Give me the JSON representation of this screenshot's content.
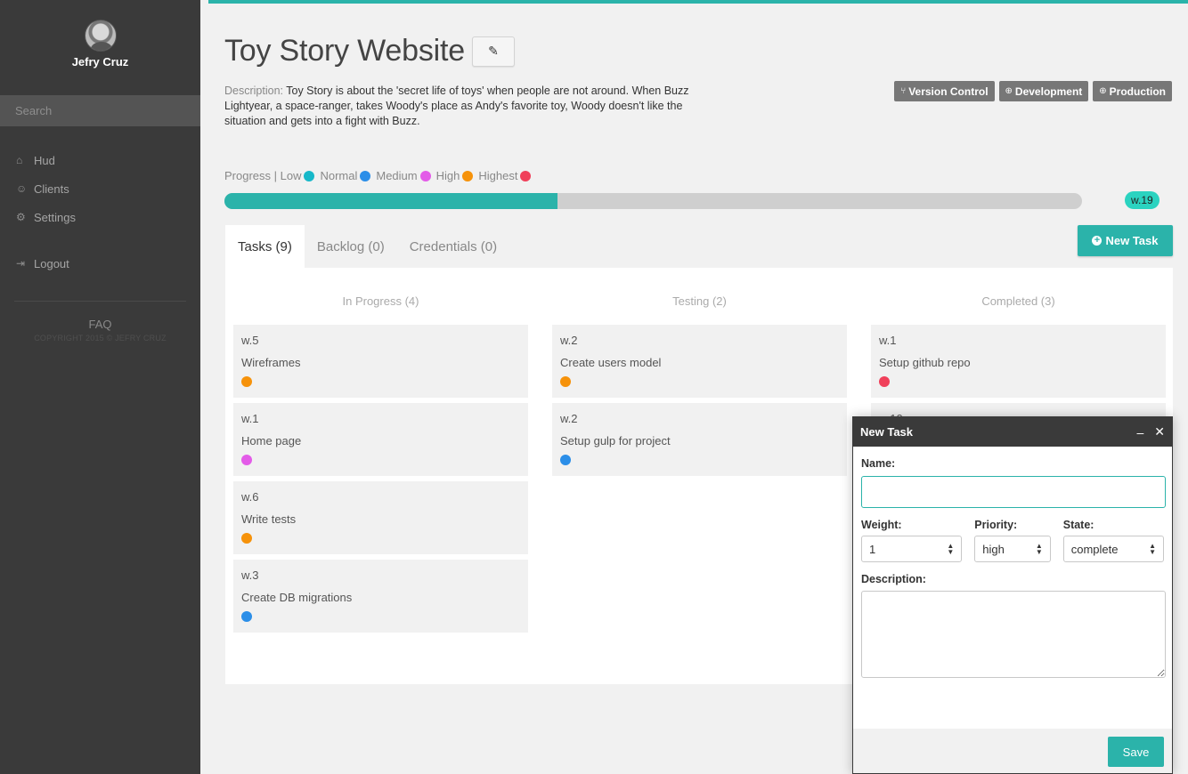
{
  "sidebar": {
    "user_name": "Jefry Cruz",
    "search_placeholder": "Search",
    "nav": [
      {
        "icon": "home-icon",
        "glyph": "⌂",
        "label": "Hud"
      },
      {
        "icon": "user-icon",
        "glyph": "☺",
        "label": "Clients"
      },
      {
        "icon": "gear-icon",
        "glyph": "⚙",
        "label": "Settings"
      }
    ],
    "logout": {
      "icon": "logout-icon",
      "glyph": "⇥",
      "label": "Logout"
    },
    "faq": "FAQ",
    "copyright": "COPYRIGHT 2015 © JEFRY CRUZ"
  },
  "project": {
    "title": "Toy Story Website",
    "edit_glyph": "✎",
    "description_label": "Description:",
    "description": "Toy Story is about the 'secret life of toys' when people are not around. When Buzz Lightyear, a space-ranger, takes Woody's place as Andy's favorite toy, Woody doesn't like the situation and gets into a fight with Buzz."
  },
  "env_buttons": [
    {
      "icon": "branch-icon",
      "glyph": "⑂",
      "label": "Version Control"
    },
    {
      "icon": "globe-icon",
      "glyph": "⊕",
      "label": "Development"
    },
    {
      "icon": "globe-icon",
      "glyph": "⊕",
      "label": "Production"
    }
  ],
  "legend": {
    "prefix": "Progress | Low",
    "items": [
      {
        "label": "Normal",
        "color": "#17b8c9"
      },
      {
        "label": "Medium",
        "color": "#2b8ee8"
      },
      {
        "label": "High",
        "color": "#e35be8"
      },
      {
        "label": "Highest",
        "color": "#f6920a"
      },
      {
        "label": "",
        "color": "#f0405a"
      }
    ],
    "low_color": "#17b8c9"
  },
  "progress": {
    "fraction": 0.388,
    "weight_label": "w.19",
    "fill_color": "#2bb3aa"
  },
  "tabs": [
    {
      "label": "Tasks (9)",
      "active": true
    },
    {
      "label": "Backlog (0)",
      "active": false
    },
    {
      "label": "Credentials (0)",
      "active": false
    }
  ],
  "new_task_label": "New Task",
  "columns": [
    {
      "title": "In Progress (4)",
      "cards": [
        {
          "weight": "w.5",
          "name": "Wireframes",
          "color": "#f6920a"
        },
        {
          "weight": "w.1",
          "name": "Home page",
          "color": "#e35be8"
        },
        {
          "weight": "w.6",
          "name": "Write tests",
          "color": "#f6920a"
        },
        {
          "weight": "w.3",
          "name": "Create DB migrations",
          "color": "#2b8ee8"
        }
      ]
    },
    {
      "title": "Testing (2)",
      "cards": [
        {
          "weight": "w.2",
          "name": "Create users model",
          "color": "#f6920a"
        },
        {
          "weight": "w.2",
          "name": "Setup gulp for project",
          "color": "#2b8ee8"
        }
      ]
    },
    {
      "title": "Completed (3)",
      "cards": [
        {
          "weight": "w.1",
          "name": "Setup github repo",
          "color": "#f0405a"
        },
        {
          "weight": "w.10",
          "name": "",
          "color": ""
        }
      ]
    }
  ],
  "modal": {
    "title": "New Task",
    "minimize_glyph": "–",
    "close_glyph": "✕",
    "name_label": "Name:",
    "name_value": "",
    "weight_label": "Weight:",
    "weight_value": "1",
    "priority_label": "Priority:",
    "priority_value": "high",
    "state_label": "State:",
    "state_value": "complete",
    "description_label": "Description:",
    "save_label": "Save"
  }
}
